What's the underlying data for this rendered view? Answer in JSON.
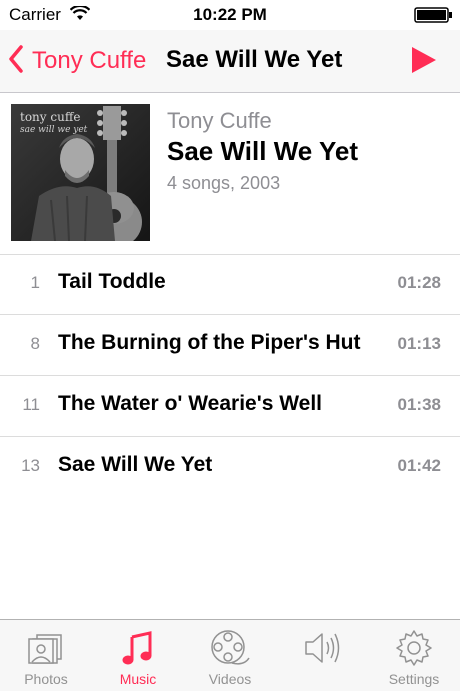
{
  "status_bar": {
    "carrier": "Carrier",
    "time": "10:22 PM"
  },
  "nav": {
    "back_label": "Tony Cuffe",
    "title": "Sae Will We Yet",
    "play_icon": "play-icon"
  },
  "album": {
    "artist": "Tony Cuffe",
    "name": "Sae Will We Yet",
    "meta": "4 songs, 2003",
    "art_title": "tony cuffe",
    "art_subtitle": "sae will we yet"
  },
  "songs": [
    {
      "number": "1",
      "title": "Tail Toddle",
      "duration": "01:28"
    },
    {
      "number": "8",
      "title": "The Burning of the Piper's Hut",
      "duration": "01:13"
    },
    {
      "number": "11",
      "title": "The Water o' Wearie's Well",
      "duration": "01:38"
    },
    {
      "number": "13",
      "title": "Sae Will We Yet",
      "duration": "01:42"
    }
  ],
  "tabs": [
    {
      "label": "Photos",
      "icon": "photos-icon"
    },
    {
      "label": "Music",
      "icon": "music-note-icon",
      "active": true
    },
    {
      "label": "Videos",
      "icon": "film-reel-icon"
    },
    {
      "label": "",
      "icon": "speaker-icon"
    },
    {
      "label": "Settings",
      "icon": "gear-icon"
    }
  ],
  "colors": {
    "accent": "#ff2d55",
    "secondary_text": "#8e8e93",
    "bar_background": "#f7f7f7"
  }
}
